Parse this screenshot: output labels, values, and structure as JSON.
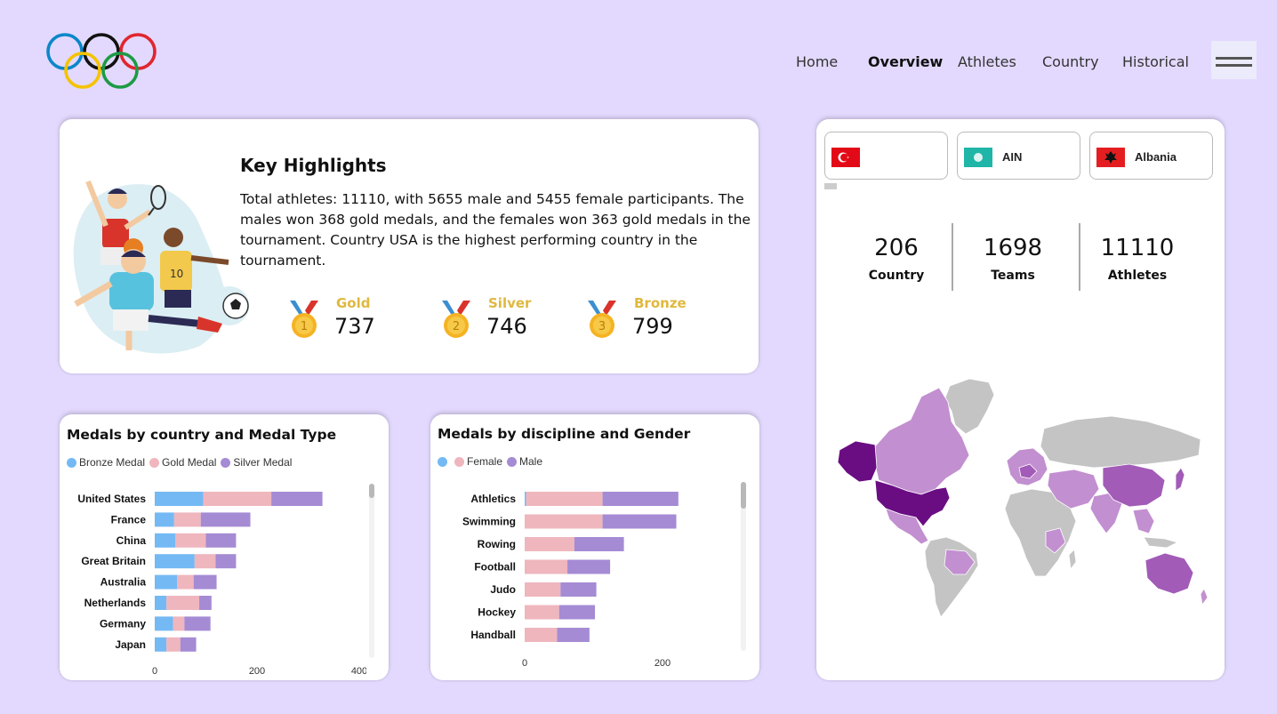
{
  "nav": {
    "items": [
      {
        "label": "Home",
        "active": false
      },
      {
        "label": "Overview",
        "active": true
      },
      {
        "label": "Athletes",
        "active": false
      },
      {
        "label": "Country",
        "active": false
      },
      {
        "label": "Historical",
        "active": false
      }
    ]
  },
  "highlights": {
    "title": "Key Highlights",
    "text": "Total athletes: 11110, with 5655 male and 5455 female participants. The males won 368 gold medals, and the females won 363 gold medals in the tournament. Country USA is the highest performing country in the tournament.",
    "medals": [
      {
        "label": "Gold",
        "value": "737",
        "number": "1"
      },
      {
        "label": "Silver",
        "value": "746",
        "number": "2"
      },
      {
        "label": "Bronze",
        "value": "799",
        "number": "3"
      }
    ]
  },
  "country_filters": [
    {
      "name": "",
      "flag": "turkey-flag-icon"
    },
    {
      "name": "AIN",
      "flag": "ain-flag-icon"
    },
    {
      "name": "Albania",
      "flag": "albania-flag-icon"
    }
  ],
  "stats": [
    {
      "value": "206",
      "label": "Country"
    },
    {
      "value": "1698",
      "label": "Teams"
    },
    {
      "value": "11110",
      "label": "Athletes"
    }
  ],
  "colors": {
    "background": "#e3d9fe",
    "bronze": "#74b9f4",
    "gold": "#efb6bd",
    "silver": "#a58bd4",
    "medal_text": "#e0b83e",
    "map_usa": "#6a0d83",
    "map_high": "#a25bb7",
    "map_mid": "#c28fd0",
    "map_none": "#c4c4c4"
  },
  "chart_data": [
    {
      "type": "bar",
      "orientation": "horizontal",
      "stacked": true,
      "title": "Medals by country and Medal Type",
      "categories": [
        "United States",
        "France",
        "China",
        "Great Britain",
        "Australia",
        "Netherlands",
        "Germany",
        "Japan"
      ],
      "series": [
        {
          "name": "Bronze Medal",
          "values": [
            95,
            38,
            40,
            78,
            44,
            23,
            36,
            23
          ]
        },
        {
          "name": "Gold Medal",
          "values": [
            133,
            52,
            60,
            41,
            32,
            64,
            22,
            27
          ]
        },
        {
          "name": "Silver Medal",
          "values": [
            100,
            97,
            59,
            40,
            45,
            24,
            51,
            31
          ]
        }
      ],
      "xticks": [
        "0",
        "200",
        "400"
      ],
      "xlim": [
        0,
        400
      ],
      "legend": "top-left"
    },
    {
      "type": "bar",
      "orientation": "horizontal",
      "stacked": true,
      "title": "Medals by discipline and Gender",
      "categories": [
        "Athletics",
        "Swimming",
        "Rowing",
        "Football",
        "Judo",
        "Hockey",
        "Handball"
      ],
      "series": [
        {
          "name": "",
          "values": [
            2,
            0,
            0,
            0,
            0,
            0,
            0
          ]
        },
        {
          "name": "Female",
          "values": [
            111,
            113,
            72,
            62,
            52,
            50,
            47
          ]
        },
        {
          "name": "Male",
          "values": [
            110,
            107,
            72,
            62,
            52,
            52,
            47
          ]
        }
      ],
      "xticks": [
        "0",
        "200"
      ],
      "xlim": [
        0,
        200
      ],
      "legend": "top-left"
    }
  ]
}
